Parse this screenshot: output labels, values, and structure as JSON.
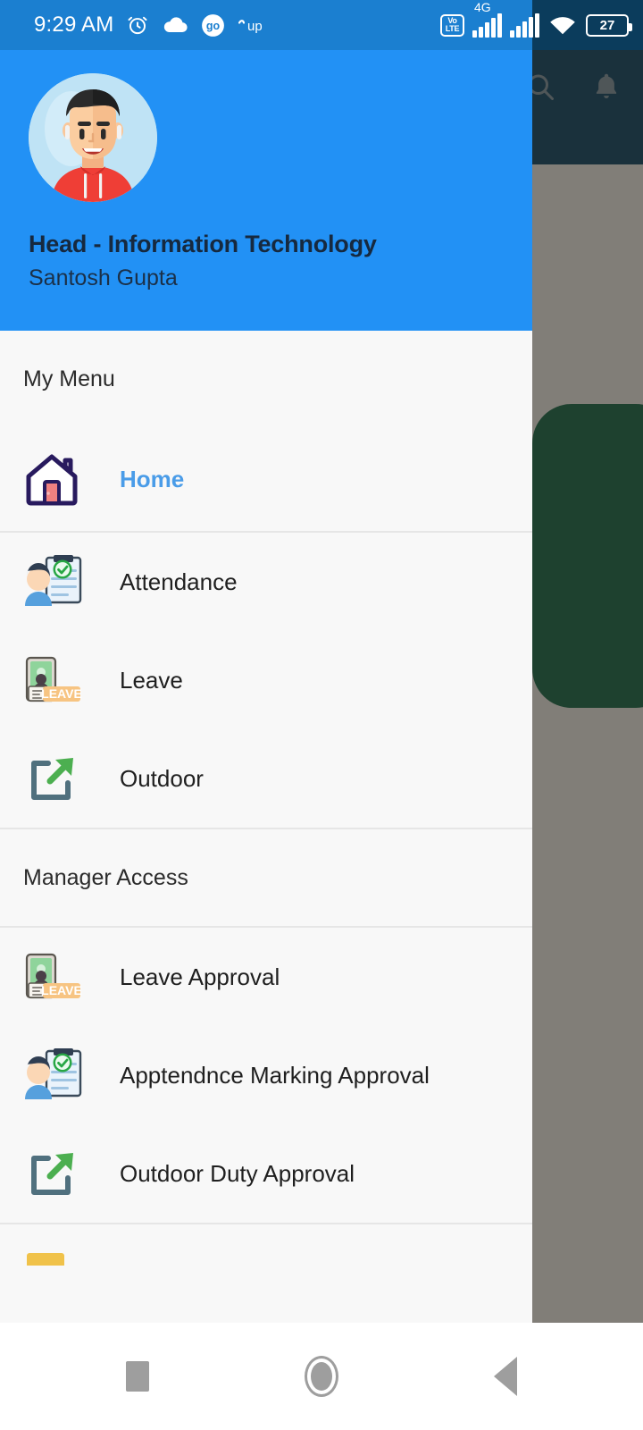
{
  "status_bar": {
    "time": "9:29 AM",
    "icons_left": [
      "alarm-clock-icon",
      "cloud-icon",
      "go-badge-icon",
      "up-icon"
    ],
    "volte_top": "Vo",
    "volte_bottom": "LTE",
    "network_generation": "4G",
    "icons_right": [
      "volte-icon",
      "signal-bars-sim1-icon",
      "signal-bars-sim2-icon",
      "wifi-icon"
    ],
    "battery_percent": "27"
  },
  "app_bar": {
    "search_icon": "search-icon",
    "notification_icon": "bell-icon"
  },
  "drawer": {
    "profile": {
      "avatar": "user-avatar-illustration",
      "role": "Head - Information Technology",
      "name": "Santosh Gupta"
    },
    "sections": [
      {
        "header": "My Menu",
        "items": [
          {
            "label": "Home",
            "icon": "home-icon",
            "active": true
          }
        ]
      },
      {
        "header": null,
        "items": [
          {
            "label": "Attendance",
            "icon": "attendance-icon",
            "active": false
          },
          {
            "label": "Leave",
            "icon": "leave-icon",
            "active": false
          },
          {
            "label": "Outdoor",
            "icon": "outdoor-icon",
            "active": false
          }
        ]
      },
      {
        "header": "Manager Access",
        "items": [
          {
            "label": "Leave Approval",
            "icon": "leave-icon",
            "active": false
          },
          {
            "label": "Apptendnce Marking Approval",
            "icon": "attendance-icon",
            "active": false
          },
          {
            "label": "Outdoor Duty Approval",
            "icon": "outdoor-icon",
            "active": false
          }
        ]
      }
    ]
  },
  "nav_bar": {
    "recents": "recents-square-icon",
    "home": "home-circle-icon",
    "back": "back-triangle-icon"
  },
  "colors": {
    "status_bar_blue": "#1b7fd0",
    "status_bar_dark": "#0b3c5c",
    "drawer_header_blue": "#2291f5",
    "app_bar_dark_blue": "#0c4468",
    "accent_blue": "#4a9ce8",
    "green_card": "#15694a",
    "scrim": "#75736c",
    "drawer_bg": "#f8f8f8",
    "divider": "#e6e6e6"
  }
}
